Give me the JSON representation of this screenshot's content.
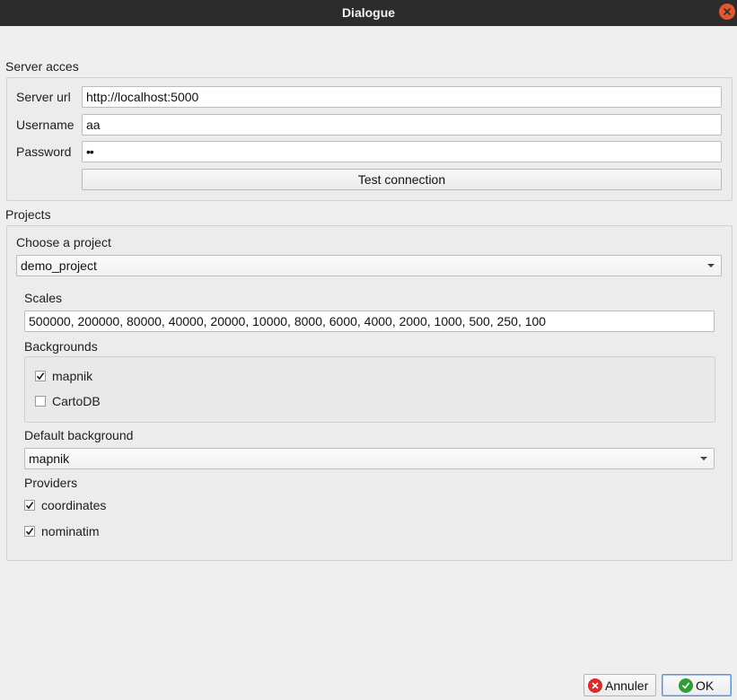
{
  "window": {
    "title": "Dialogue"
  },
  "server": {
    "group_label": "Server acces",
    "url_label": "Server url",
    "url_value": "http://localhost:5000",
    "username_label": "Username",
    "username_value": "aa",
    "password_label": "Password",
    "password_value": "••",
    "test_button": "Test connection"
  },
  "projects": {
    "group_label": "Projects",
    "choose_label": "Choose a project",
    "selected_project": "demo_project",
    "scales_label": "Scales",
    "scales_value": "500000, 200000, 80000, 40000, 20000, 10000, 8000, 6000, 4000, 2000, 1000, 500, 250, 100",
    "backgrounds_label": "Backgrounds",
    "backgrounds": [
      {
        "label": "mapnik",
        "checked": true
      },
      {
        "label": "CartoDB",
        "checked": false
      }
    ],
    "default_background_label": "Default background",
    "default_background_value": "mapnik",
    "providers_label": "Providers",
    "providers": [
      {
        "label": "coordinates",
        "checked": true
      },
      {
        "label": "nominatim",
        "checked": true
      }
    ]
  },
  "buttons": {
    "cancel": "Annuler",
    "ok": "OK"
  },
  "colors": {
    "titlebar": "#2c2c2c",
    "close": "#e4572e",
    "cancel_icon": "#d92b2b",
    "ok_icon": "#2e9d3a"
  },
  "icons": {
    "close": "close-icon",
    "cancel": "cancel-icon",
    "ok": "check-icon"
  }
}
